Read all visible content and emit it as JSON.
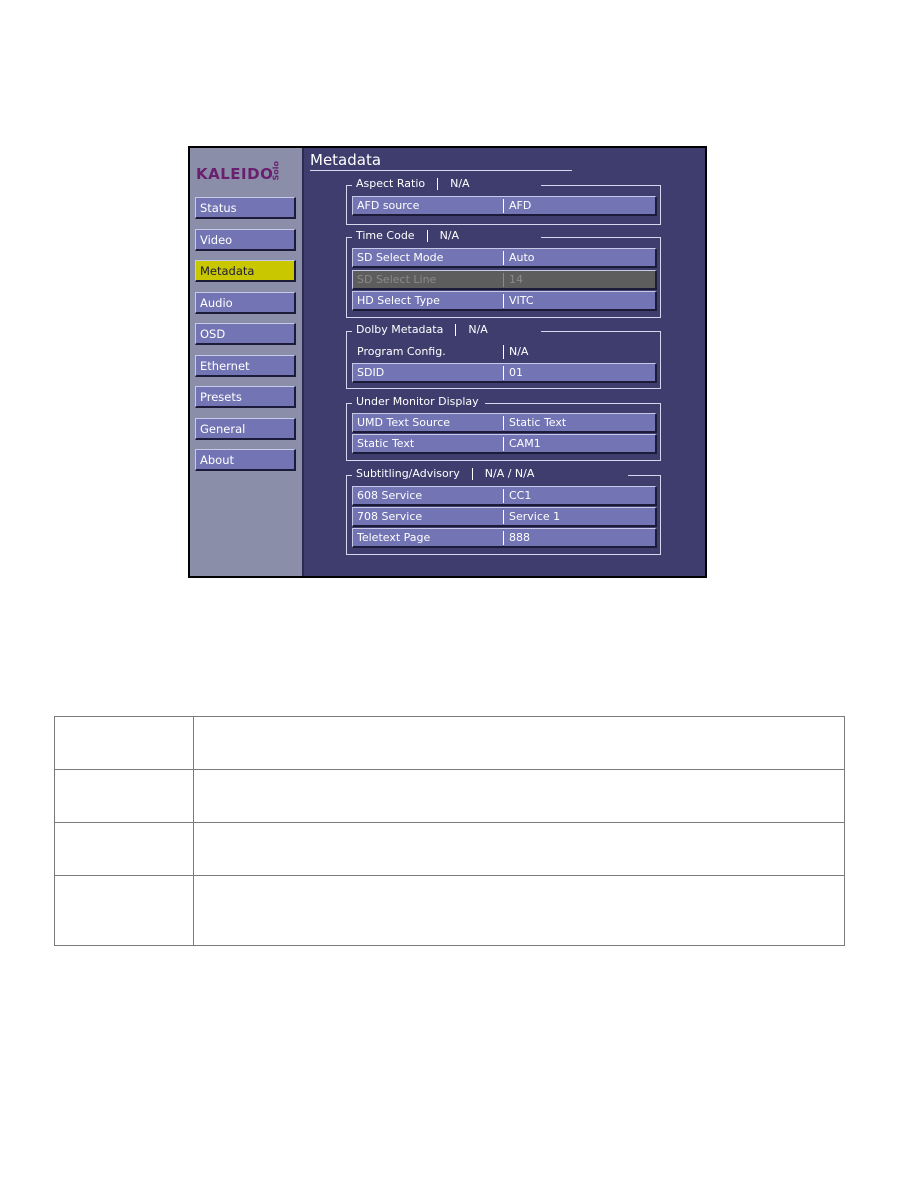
{
  "logo": {
    "main": "KALEIDO",
    "sub": "Solo",
    "color": "#6a1f6e"
  },
  "sidebar": {
    "items": [
      {
        "label": "Status",
        "active": false
      },
      {
        "label": "Video",
        "active": false
      },
      {
        "label": "Metadata",
        "active": true
      },
      {
        "label": "Audio",
        "active": false
      },
      {
        "label": "OSD",
        "active": false
      },
      {
        "label": "Ethernet",
        "active": false
      },
      {
        "label": "Presets",
        "active": false
      },
      {
        "label": "General",
        "active": false
      },
      {
        "label": "About",
        "active": false
      }
    ]
  },
  "main": {
    "title": "Metadata",
    "groups": {
      "aspect_ratio": {
        "title": "Aspect Ratio",
        "status": "N/A",
        "rows": [
          {
            "label": "AFD source",
            "value": "AFD"
          }
        ]
      },
      "time_code": {
        "title": "Time Code",
        "status": "N/A",
        "rows": [
          {
            "label": "SD Select Mode",
            "value": "Auto"
          },
          {
            "label": "SD Select Line",
            "value": "14",
            "disabled": true
          },
          {
            "label": "HD Select Type",
            "value": "VITC"
          }
        ]
      },
      "dolby": {
        "title": "Dolby Metadata",
        "status": "N/A",
        "rows": [
          {
            "label": "Program Config.",
            "value": "N/A",
            "readonly": true
          },
          {
            "label": "SDID",
            "value": "01"
          }
        ]
      },
      "umd": {
        "title": "Under Monitor Display",
        "rows": [
          {
            "label": "UMD Text Source",
            "value": "Static Text"
          },
          {
            "label": "Static Text",
            "value": "CAM1"
          }
        ]
      },
      "subtitling": {
        "title": "Subtitling/Advisory",
        "status": "N/A / N/A",
        "rows": [
          {
            "label": "608 Service",
            "value": "CC1"
          },
          {
            "label": "708 Service",
            "value": "Service 1"
          },
          {
            "label": "Teletext Page",
            "value": "888"
          }
        ]
      }
    }
  },
  "colors": {
    "panel_bg": "#3f3d6e",
    "sidebar_bg": "#8a8ea8",
    "button_bg": "#7274b4",
    "active_bg": "#c9c800",
    "disabled_bg": "#5d5d5d"
  },
  "doc_table": {
    "rows": [
      {
        "col1": "",
        "col2": ""
      },
      {
        "col1": "",
        "col2": ""
      },
      {
        "col1": "",
        "col2": ""
      },
      {
        "col1": "",
        "col2": ""
      }
    ]
  }
}
